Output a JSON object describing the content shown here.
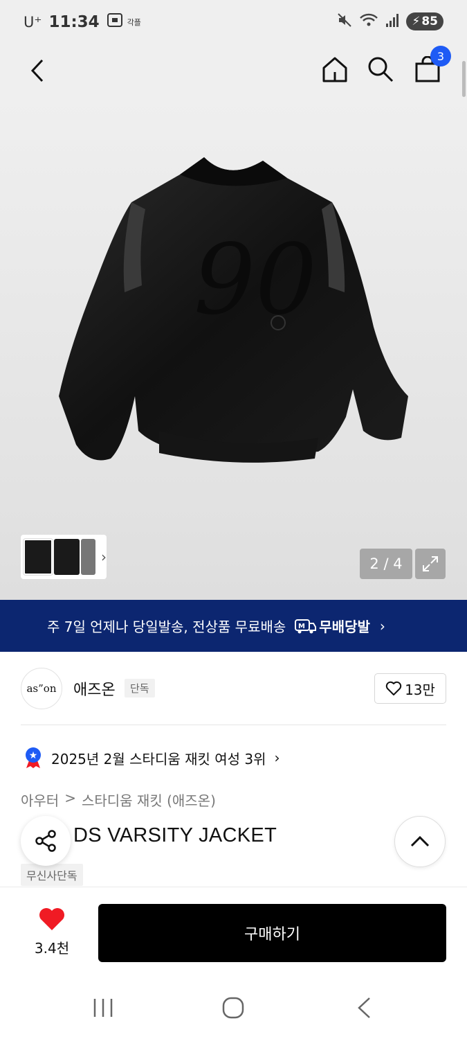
{
  "status_bar": {
    "carrier": "U⁺",
    "time": "11:34",
    "extra_label": "각플",
    "battery": "85"
  },
  "nav": {
    "cart_count": "3"
  },
  "gallery": {
    "counter": "2 / 4"
  },
  "banner": {
    "text": "주 7일 언제나 당일발송, 전상품 무료배송",
    "tag": "무배당발"
  },
  "brand": {
    "logo_text": "as”on",
    "name": "애즈온",
    "badge": "단독",
    "likes": "13만"
  },
  "ranking": {
    "text": "2025년 2월 스타디움 재킷 여성 3위"
  },
  "breadcrumb": {
    "level1": "아우터",
    "separator": ">",
    "level2": "스타디움 재킷 (애즈온)"
  },
  "product": {
    "title": "DS VARSITY JACKET",
    "badge": "무신사단독"
  },
  "bottom_bar": {
    "wish_count": "3.4천",
    "buy_label": "구매하기"
  },
  "colors": {
    "banner_bg": "#0c2670",
    "badge_blue": "#1e5bf5",
    "heart_red": "#f01b24"
  }
}
